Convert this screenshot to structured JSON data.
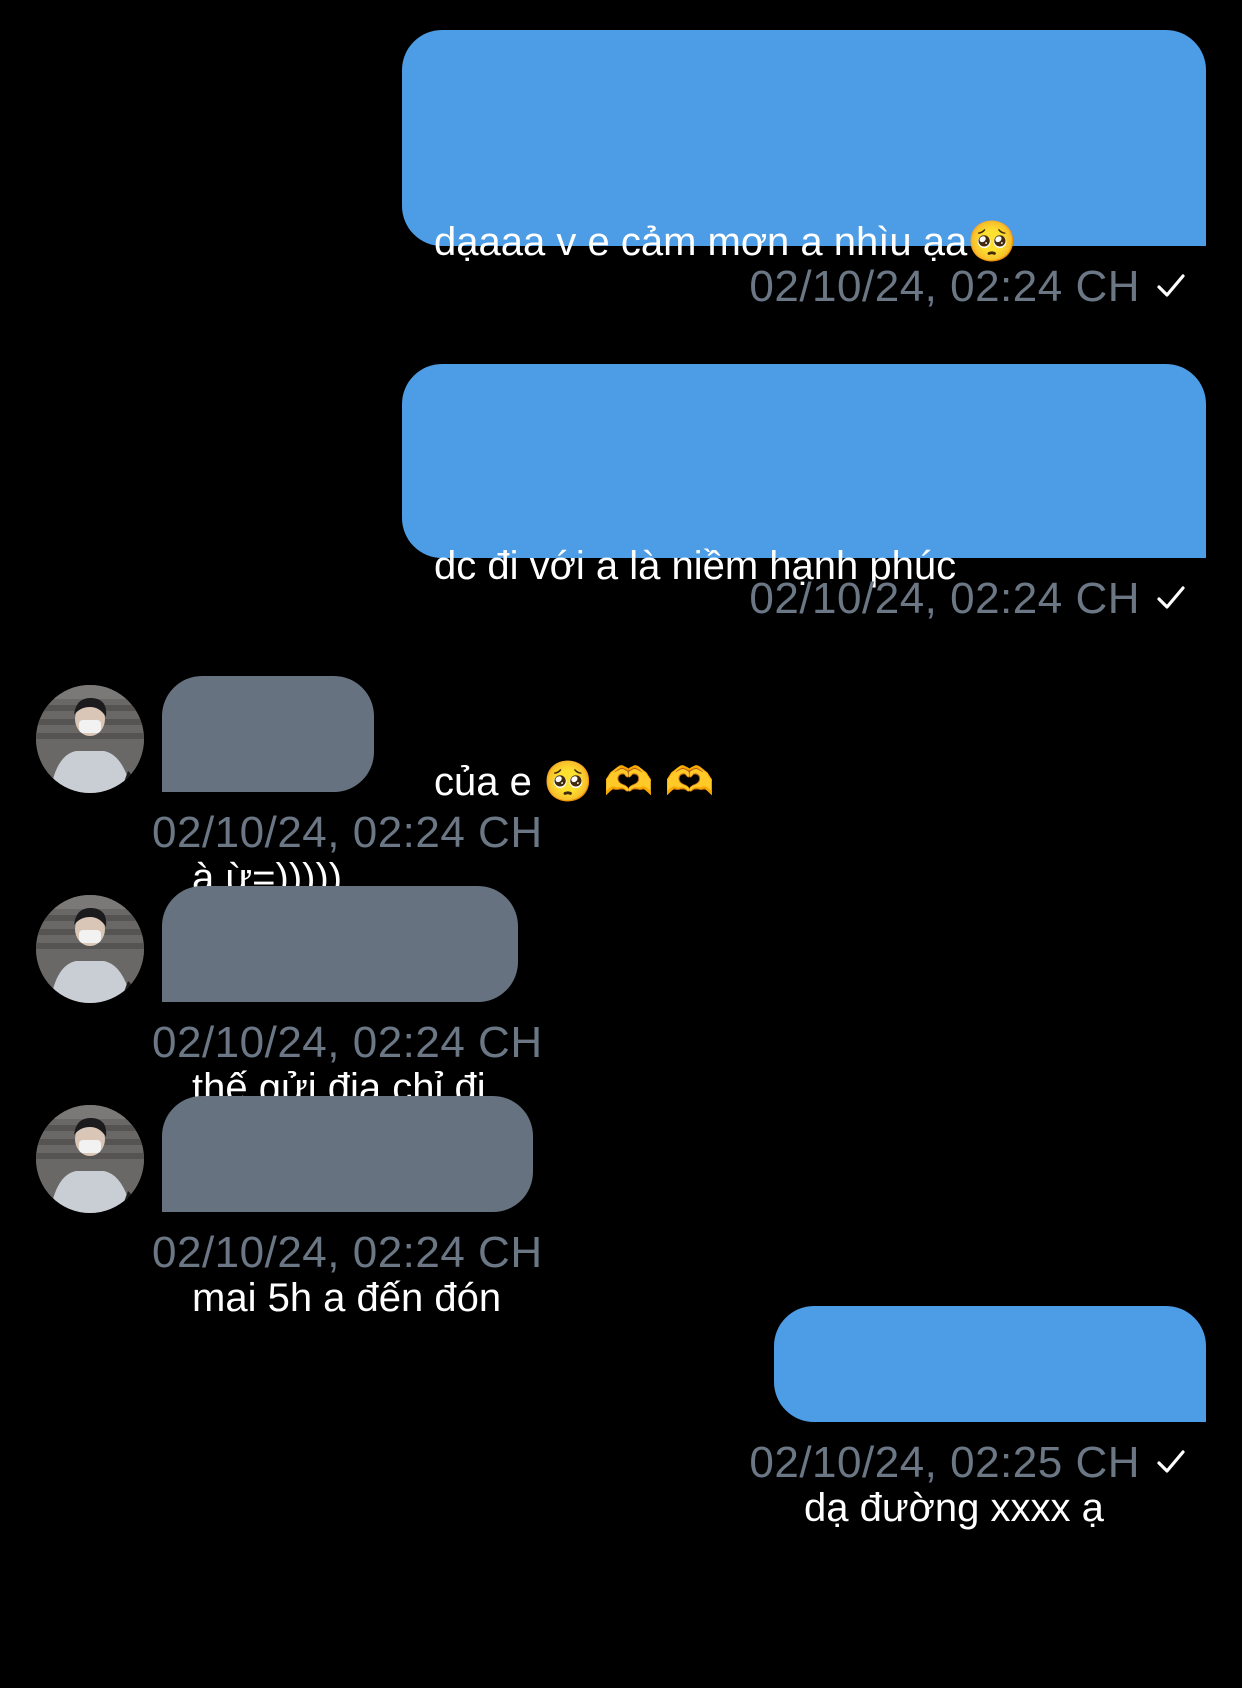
{
  "messages": [
    {
      "direction": "outgoing",
      "text_line1": "dạaaa v e cảm mơn a nhìu ạa🥺",
      "text_line2": "🥺 💖 💖 💖",
      "timestamp": "02/10/24, 02:24 CH",
      "status": "sent-check-icon"
    },
    {
      "direction": "outgoing",
      "text_line1": "dc đi với a là niềm hạnh phúc",
      "text_line2": "của e 🥺 🫶 🫶",
      "timestamp": "02/10/24, 02:24 CH",
      "status": "sent-check-icon"
    },
    {
      "direction": "incoming",
      "text": "à ừ=)))))",
      "timestamp": "02/10/24, 02:24 CH",
      "avatar": "contact-avatar"
    },
    {
      "direction": "incoming",
      "text": "thế gửi địa chỉ đi",
      "timestamp": "02/10/24, 02:24 CH",
      "avatar": "contact-avatar"
    },
    {
      "direction": "incoming",
      "text": "mai 5h a đến đón",
      "timestamp": "02/10/24, 02:24 CH",
      "avatar": "contact-avatar"
    },
    {
      "direction": "outgoing",
      "text": "dạ đường xxxx ạ",
      "timestamp": "02/10/24, 02:25 CH",
      "status": "sent-check-icon"
    }
  ],
  "colors": {
    "background": "#000000",
    "outgoing_bubble": "#4d9de6",
    "incoming_bubble": "#66727f",
    "timestamp": "#6b7785",
    "text": "#ffffff"
  }
}
